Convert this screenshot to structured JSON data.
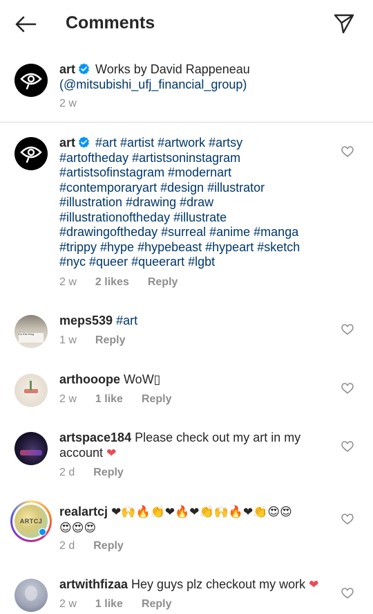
{
  "header": {
    "title": "Comments"
  },
  "caption": {
    "username": "art",
    "text": "Works by David Rappeneau",
    "mention": "(@mitsubishi_ufj_financial_group)",
    "time": "2 w"
  },
  "comments": [
    {
      "username": "art",
      "hashtags_line1": "#art #artist #artwork #artsy",
      "hashtags_line2": "#artoftheday #artistsoninstagram",
      "hashtags_line3": "#artistsofinstagram #modernart",
      "hashtags_line4": "#contemporaryart #design #illustrator",
      "hashtags_line5": "#illustration #drawing #draw",
      "hashtags_line6": "#illustrationoftheday #illustrate",
      "hashtags_line7": "#drawingoftheday #surreal #anime #manga",
      "hashtags_line8": "#trippy #hype #hypebeast #hypeart #sketch",
      "hashtags_line9": "#nyc #queer #queerart #lgbt",
      "time": "2 w",
      "likes": "2 likes",
      "reply": "Reply"
    },
    {
      "username": "meps539",
      "tag": "#art",
      "time": "1 w",
      "reply": "Reply",
      "avatar_text": "Do this thing"
    },
    {
      "username": "arthooope",
      "text": "WoW▯",
      "time": "2 w",
      "likes": "1 like",
      "reply": "Reply"
    },
    {
      "username": "artspace184",
      "text": "Please check out my art in my",
      "text2": "account",
      "emoji": "❤",
      "time": "2 d",
      "reply": "Reply"
    },
    {
      "username": "realartcj",
      "emoji_line1": "❤🙌🔥👏❤🔥❤👏🙌🔥❤👏😍😍",
      "emoji_line2": "😍😍😍",
      "avatar_text": "ARTCJ",
      "time": "2 d",
      "reply": "Reply"
    },
    {
      "username": "artwithfizaa",
      "text": "Hey guys plz checkout my work",
      "emoji": "❤",
      "time": "2 w",
      "likes": "1 like",
      "reply": "Reply"
    }
  ],
  "colors": {
    "link": "#00376b",
    "meta": "#8e8e8e",
    "verified": "#0095f6",
    "heart": "#ed4956"
  }
}
